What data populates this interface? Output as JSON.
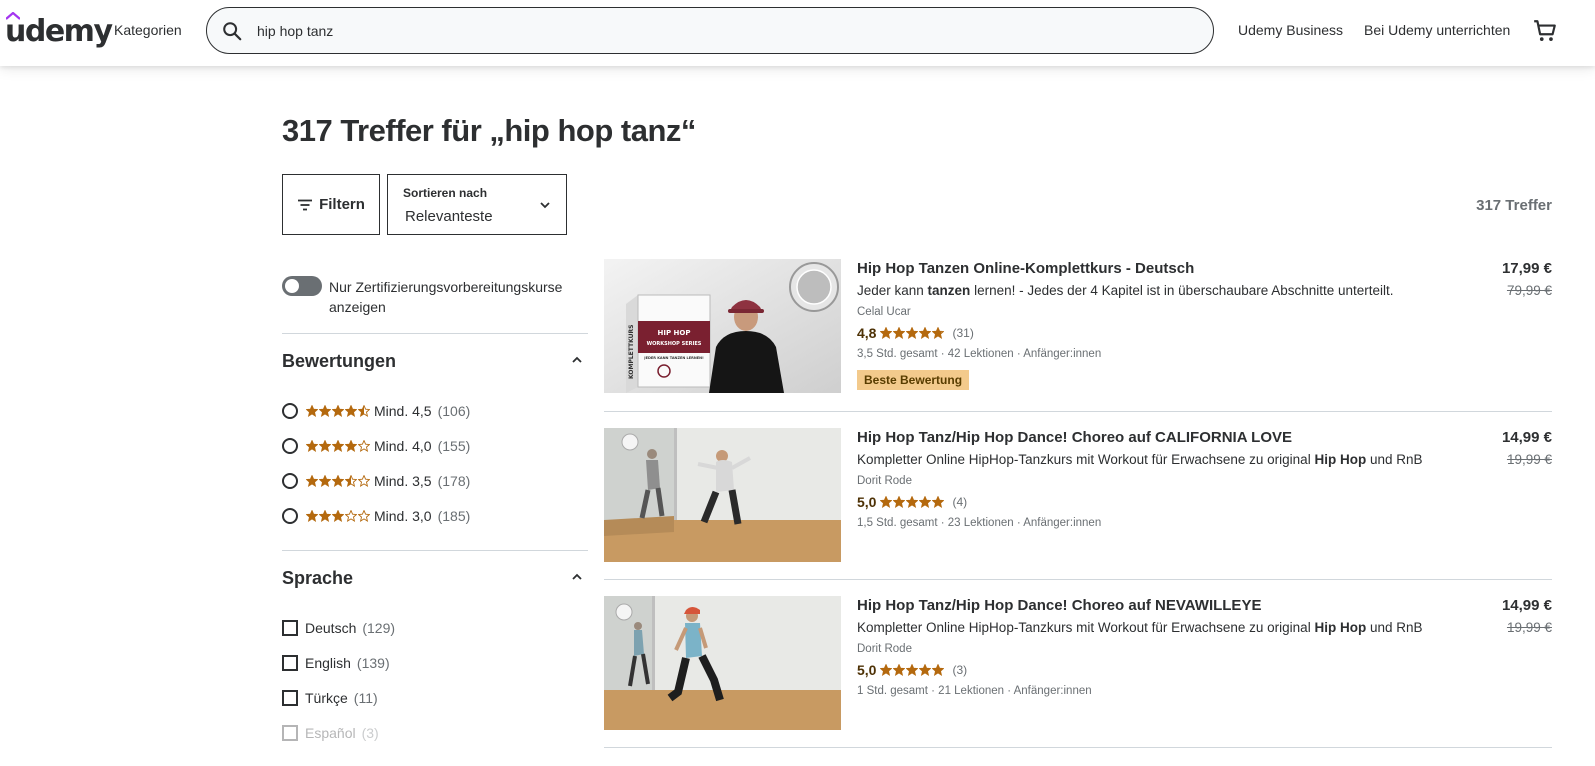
{
  "header": {
    "logo": "udemy",
    "categories": "Kategorien",
    "search_value": "hip hop tanz",
    "business": "Udemy Business",
    "teach": "Bei Udemy unterrichten"
  },
  "results": {
    "title": "317 Treffer für „hip hop tanz“",
    "count": "317 Treffer"
  },
  "toolbar": {
    "filter_label": "Filtern",
    "sort_label": "Sortieren nach",
    "sort_value": "Relevanteste"
  },
  "sidebar": {
    "toggle_label": "Nur Zertifizierungsvorbereitungskurse anzeigen",
    "ratings_title": "Bewertungen",
    "ratings": [
      {
        "label": "Mind. 4,5",
        "count": "(106)",
        "stars": 4.5
      },
      {
        "label": "Mind. 4,0",
        "count": "(155)",
        "stars": 4.0
      },
      {
        "label": "Mind. 3,5",
        "count": "(178)",
        "stars": 3.5
      },
      {
        "label": "Mind. 3,0",
        "count": "(185)",
        "stars": 3.0
      }
    ],
    "language_title": "Sprache",
    "languages": [
      {
        "label": "Deutsch",
        "count": "(129)"
      },
      {
        "label": "English",
        "count": "(139)"
      },
      {
        "label": "Türkçe",
        "count": "(11)"
      },
      {
        "label": "Español",
        "count": "(3)"
      }
    ]
  },
  "courses": [
    {
      "title": "Hip Hop Tanzen Online-Komplettkurs - Deutsch",
      "desc_pre": "Jeder kann ",
      "desc_bold": "tanzen",
      "desc_post": " lernen! - Jedes der 4 Kapitel ist in überschaubare Abschnitte unterteilt.",
      "author": "Celal Ucar",
      "rating": "4,8",
      "rating_value": 4.8,
      "rating_count": "(31)",
      "meta": "3,5 Std. gesamt · 42 Lektionen · Anfänger:innen",
      "badge": "Beste Bewertung",
      "price": "17,99 €",
      "old_price": "79,99 €",
      "thumb_text_1": "HIP HOP",
      "thumb_text_2": "WORKSHOP SERIES",
      "thumb_text_3": "KOMPLETTKURS",
      "thumb_text_4": "JEDER KANN TANZEN LERNEN!"
    },
    {
      "title": "Hip Hop Tanz/Hip Hop Dance! Choreo auf CALIFORNIA LOVE",
      "desc_pre": "Kompletter Online HipHop-Tanzkurs mit Workout für Erwachsene zu original ",
      "desc_bold": "Hip Hop",
      "desc_post": " und RnB",
      "author": "Dorit Rode",
      "rating": "5,0",
      "rating_value": 5.0,
      "rating_count": "(4)",
      "meta": "1,5 Std. gesamt · 23 Lektionen · Anfänger:innen",
      "price": "14,99 €",
      "old_price": "19,99 €"
    },
    {
      "title": "Hip Hop Tanz/Hip Hop Dance! Choreo auf NEVAWILLEYE",
      "desc_pre": "Kompletter Online HipHop-Tanzkurs mit Workout für Erwachsene zu original ",
      "desc_bold": "Hip Hop",
      "desc_post": " und RnB",
      "author": "Dorit Rode",
      "rating": "5,0",
      "rating_value": 5.0,
      "rating_count": "(3)",
      "meta": "1 Std. gesamt · 21 Lektionen · Anfänger:innen",
      "price": "14,99 €",
      "old_price": "19,99 €"
    }
  ],
  "colors": {
    "star": "#b4690e",
    "text": "#2d2f31",
    "muted": "#6a6f73",
    "badge_best": "#f3ca8c",
    "brand": "#a435f0"
  }
}
